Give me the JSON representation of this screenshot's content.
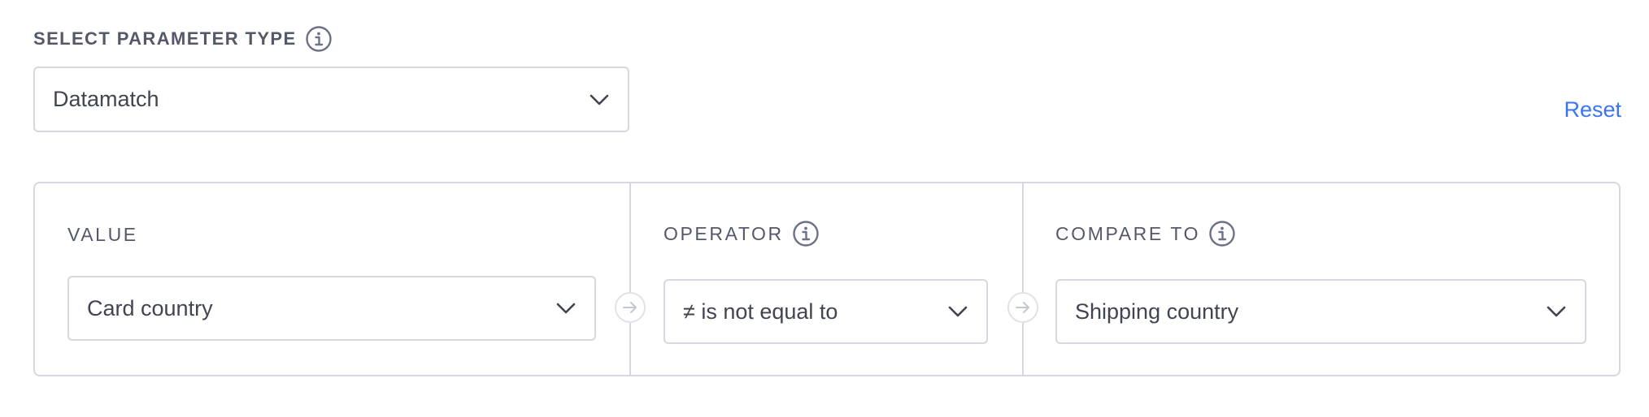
{
  "parameter_type": {
    "label": "SELECT PARAMETER TYPE",
    "info_icon": "info-icon",
    "selected": "Datamatch"
  },
  "reset": {
    "label": "Reset",
    "color": "#3b74f0"
  },
  "condition": {
    "value": {
      "label": "VALUE",
      "selected": "Card country"
    },
    "operator": {
      "label": "OPERATOR",
      "info_icon": "info-icon",
      "selected": "≠ is not equal to"
    },
    "compare_to": {
      "label": "COMPARE TO",
      "info_icon": "info-icon",
      "selected": "Shipping country"
    },
    "connector_icon": "arrow-right-icon"
  },
  "colors": {
    "text": "#414552",
    "label": "#545969",
    "border": "#d5d8df",
    "link": "#3b74f0"
  }
}
